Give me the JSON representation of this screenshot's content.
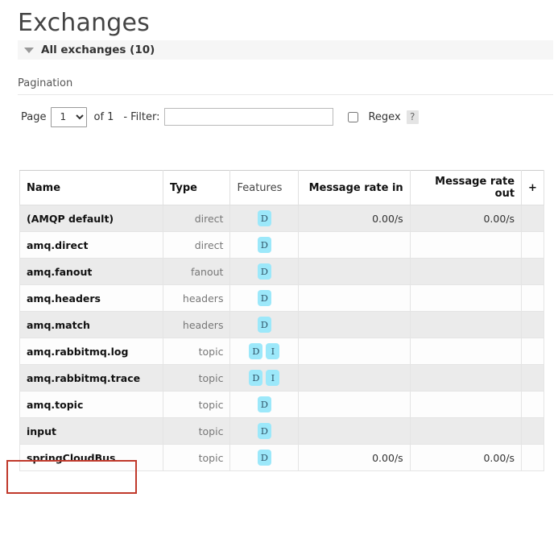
{
  "page": {
    "title": "Exchanges",
    "section_label": "All exchanges (10)",
    "collapse_icon": "triangle-down-icon"
  },
  "pagination": {
    "title": "Pagination",
    "page_word": "Page",
    "page_value": "1",
    "of_count": "of 1",
    "dash": "-",
    "filter_label": "Filter:",
    "filter_value": "",
    "filter_placeholder": "",
    "regex_label": "Regex",
    "regex_checked": false,
    "help_label": "?"
  },
  "table": {
    "columns": [
      {
        "label": "Name",
        "bold": true
      },
      {
        "label": "Type",
        "bold": true
      },
      {
        "label": "Features",
        "bold": false
      },
      {
        "label": "Message rate in",
        "bold": true
      },
      {
        "label": "Message rate out",
        "bold": true
      },
      {
        "label": "+",
        "bold": false
      }
    ],
    "rows": [
      {
        "name": "(AMQP default)",
        "type": "direct",
        "features": [
          "D"
        ],
        "rate_in": "0.00/s",
        "rate_out": "0.00/s"
      },
      {
        "name": "amq.direct",
        "type": "direct",
        "features": [
          "D"
        ],
        "rate_in": "",
        "rate_out": ""
      },
      {
        "name": "amq.fanout",
        "type": "fanout",
        "features": [
          "D"
        ],
        "rate_in": "",
        "rate_out": ""
      },
      {
        "name": "amq.headers",
        "type": "headers",
        "features": [
          "D"
        ],
        "rate_in": "",
        "rate_out": ""
      },
      {
        "name": "amq.match",
        "type": "headers",
        "features": [
          "D"
        ],
        "rate_in": "",
        "rate_out": ""
      },
      {
        "name": "amq.rabbitmq.log",
        "type": "topic",
        "features": [
          "D",
          "I"
        ],
        "rate_in": "",
        "rate_out": ""
      },
      {
        "name": "amq.rabbitmq.trace",
        "type": "topic",
        "features": [
          "D",
          "I"
        ],
        "rate_in": "",
        "rate_out": ""
      },
      {
        "name": "amq.topic",
        "type": "topic",
        "features": [
          "D"
        ],
        "rate_in": "",
        "rate_out": ""
      },
      {
        "name": "input",
        "type": "topic",
        "features": [
          "D"
        ],
        "rate_in": "",
        "rate_out": "",
        "highlighted": true
      },
      {
        "name": "springCloudBus",
        "type": "topic",
        "features": [
          "D"
        ],
        "rate_in": "0.00/s",
        "rate_out": "0.00/s"
      }
    ]
  },
  "colors": {
    "badge_bg": "#9ce8fa",
    "badge_text": "#31576b",
    "highlight_border": "#c0392b",
    "row_odd": "#ebebeb",
    "row_even": "#fdfdfd"
  }
}
